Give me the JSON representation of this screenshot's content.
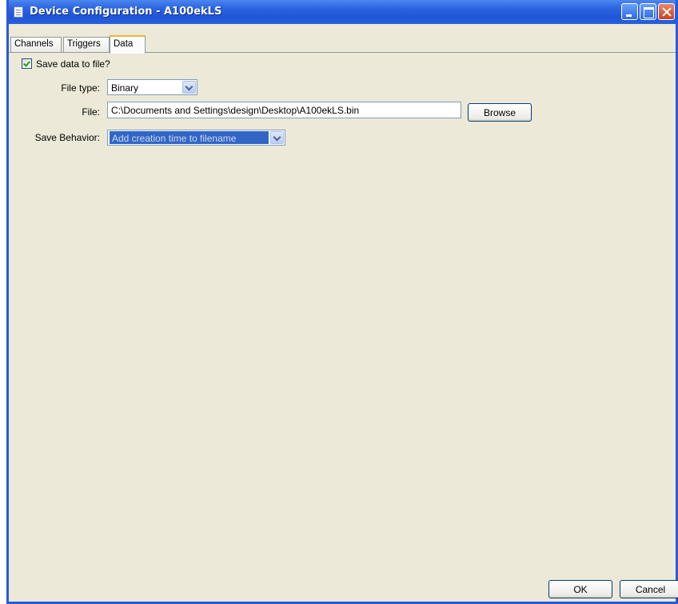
{
  "window": {
    "title": "Device Configuration - A100ekLS"
  },
  "tabs": [
    {
      "label": "Channels",
      "active": false
    },
    {
      "label": "Triggers",
      "active": false
    },
    {
      "label": "Data",
      "active": true
    }
  ],
  "data_tab": {
    "save_to_file": {
      "label": "Save data to file?",
      "checked": true
    },
    "file_type": {
      "label": "File type:",
      "value": "Binary"
    },
    "file": {
      "label": "File:",
      "value": "C:\\Documents and Settings\\design\\Desktop\\A100ekLS.bin",
      "browse_label": "Browse"
    },
    "save_behavior": {
      "label": "Save Behavior:",
      "value": "Add creation time to filename"
    }
  },
  "footer": {
    "ok_label": "OK",
    "cancel_label": "Cancel"
  },
  "colors": {
    "titlebar": "#2b64e0",
    "window_bg": "#ece9d8",
    "selection": "#3166c6",
    "checkmark": "#21a121",
    "active_tab_accent": "#f0b33a"
  },
  "icons": {
    "app": "document-icon",
    "minimize": "minimize-icon",
    "maximize": "maximize-icon",
    "close": "close-icon",
    "dropdown": "chevron-down-icon",
    "check": "checkmark-icon"
  }
}
